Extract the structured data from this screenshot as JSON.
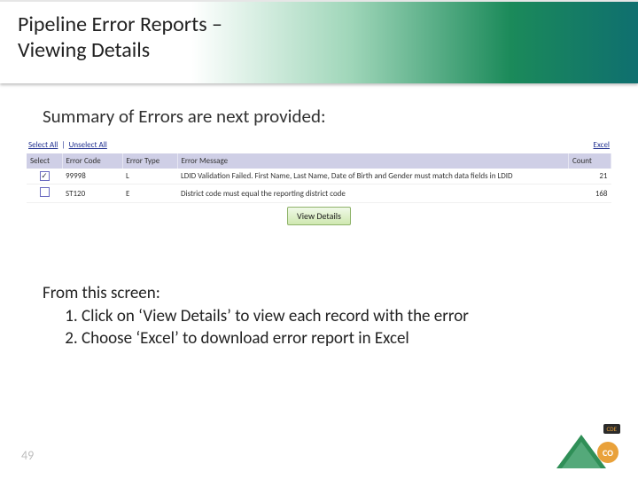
{
  "title_line1": "Pipeline Error Reports –",
  "title_line2": "Viewing Details",
  "subheading": "Summary of Errors are next provided:",
  "links": {
    "select_all": "Select All",
    "unselect_all": "Unselect All",
    "excel": "Excel"
  },
  "table": {
    "headers": {
      "select": "Select",
      "error_code": "Error Code",
      "error_type": "Error Type",
      "error_message": "Error Message",
      "count": "Count"
    },
    "rows": [
      {
        "checked": true,
        "code": "99998",
        "type": "L",
        "message": "LDID Validation Failed. First Name, Last Name, Date of Birth and Gender must match data fields in LDID",
        "count": "21"
      },
      {
        "checked": false,
        "code": "ST120",
        "type": "E",
        "message": "District code must equal the reporting district code",
        "count": "168"
      }
    ]
  },
  "view_details_btn": "View Details",
  "body": {
    "intro": "From this screen:",
    "items": [
      "Click on ‘View Details’ to view each record with the error",
      "Choose ‘Excel’ to download error report in Excel"
    ]
  },
  "page_number": "49",
  "logo": {
    "co": "CO",
    "cde": "CDE"
  }
}
